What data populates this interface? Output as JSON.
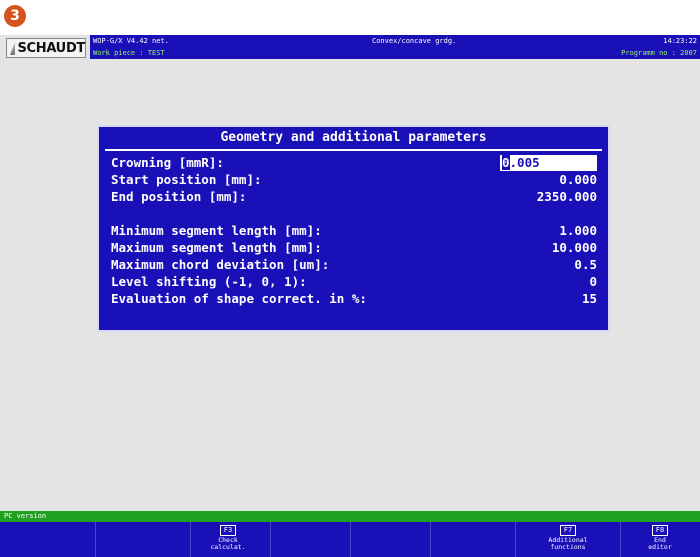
{
  "step_badge": "3",
  "header": {
    "logo_text": "SCHAUDT",
    "version": "WOP-G/X V4.42 net.",
    "mode": "Convex/concave grdg.",
    "time": "14:23:22",
    "work_piece": "Work piece : TEST",
    "program_no": "Programm no : 2007"
  },
  "dialog": {
    "title": "Geometry and additional parameters",
    "rows": [
      {
        "label": "Crowning [mmR]:",
        "value_caret": "0",
        "value_rest": ".005"
      },
      {
        "label": "Start position [mm]:",
        "value": "0.000"
      },
      {
        "label": "End position [mm]:",
        "value": "2350.000"
      },
      {
        "label": "Minimum segment length [mm]:",
        "value": "1.000"
      },
      {
        "label": "Maximum segment length [mm]:",
        "value": "10.000"
      },
      {
        "label": "Maximum chord deviation [um]:",
        "value": "0.5"
      },
      {
        "label": "Level shifting (-1, 0, 1):",
        "value": "0"
      },
      {
        "label": "Evaluation of shape correct. in %:",
        "value": "15"
      }
    ]
  },
  "status": {
    "text": "PC version"
  },
  "fkeys": [
    {
      "key": "F3",
      "line1": "Check",
      "line2": "calculat."
    },
    {
      "key": "F7",
      "line1": "Additional",
      "line2": "functions"
    },
    {
      "key": "F8",
      "line1": "End",
      "line2": "editor"
    }
  ],
  "colors": {
    "screen_blue": "#1a10b8",
    "status_green": "#20a020",
    "badge_orange": "#d3541e",
    "background_gray": "#e4e4e4"
  }
}
